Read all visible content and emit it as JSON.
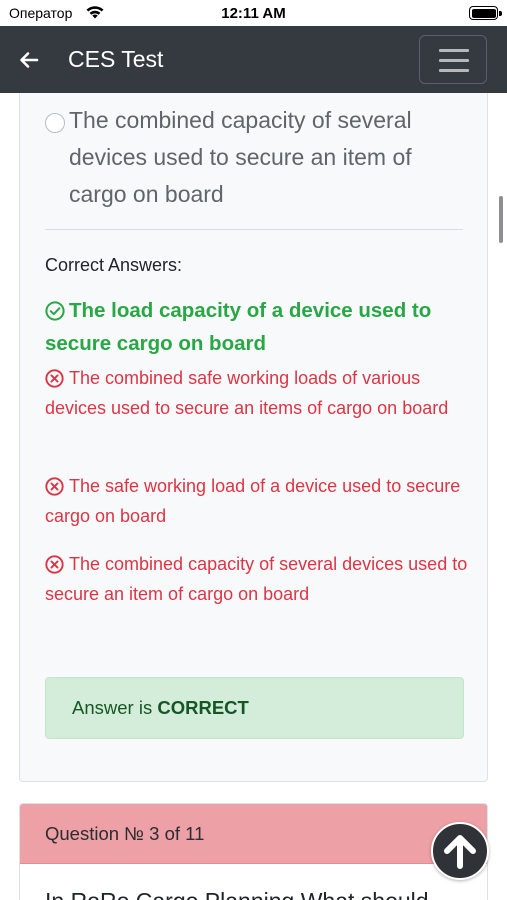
{
  "status_bar": {
    "carrier": "Оператор",
    "time": "12:11 AM"
  },
  "app_bar": {
    "title": "CES Test"
  },
  "question": {
    "option_text": "The combined capacity of several devices used to secure an item of cargo on board",
    "correct_answers_label": "Correct Answers:",
    "answers": [
      {
        "text": "The load capacity of a device used to secure cargo on board",
        "status": "correct"
      },
      {
        "text": "The combined safe working loads of various devices used to secure an items of cargo on board",
        "status": "incorrect"
      },
      {
        "text": "The safe working load of a device used to secure cargo on board",
        "status": "incorrect"
      },
      {
        "text": "The combined capacity of several devices used to secure an item of cargo on board",
        "status": "incorrect"
      }
    ],
    "result_prefix": "Answer is",
    "result_value": "CORRECT"
  },
  "next_question": {
    "header": "Question № 3 of 11",
    "body_partial": "In RoRo Cargo Planning What should"
  },
  "colors": {
    "app_bar": "#343a40",
    "correct": "#28a745",
    "incorrect": "#dc3545",
    "result_bg": "#d4edda",
    "question_header_bg": "#eda0a5"
  },
  "icons": {
    "back": "arrow-left-icon",
    "menu": "hamburger-menu-icon",
    "correct": "check-circle-icon",
    "incorrect": "x-circle-icon",
    "scroll_top": "arrow-up-icon"
  }
}
